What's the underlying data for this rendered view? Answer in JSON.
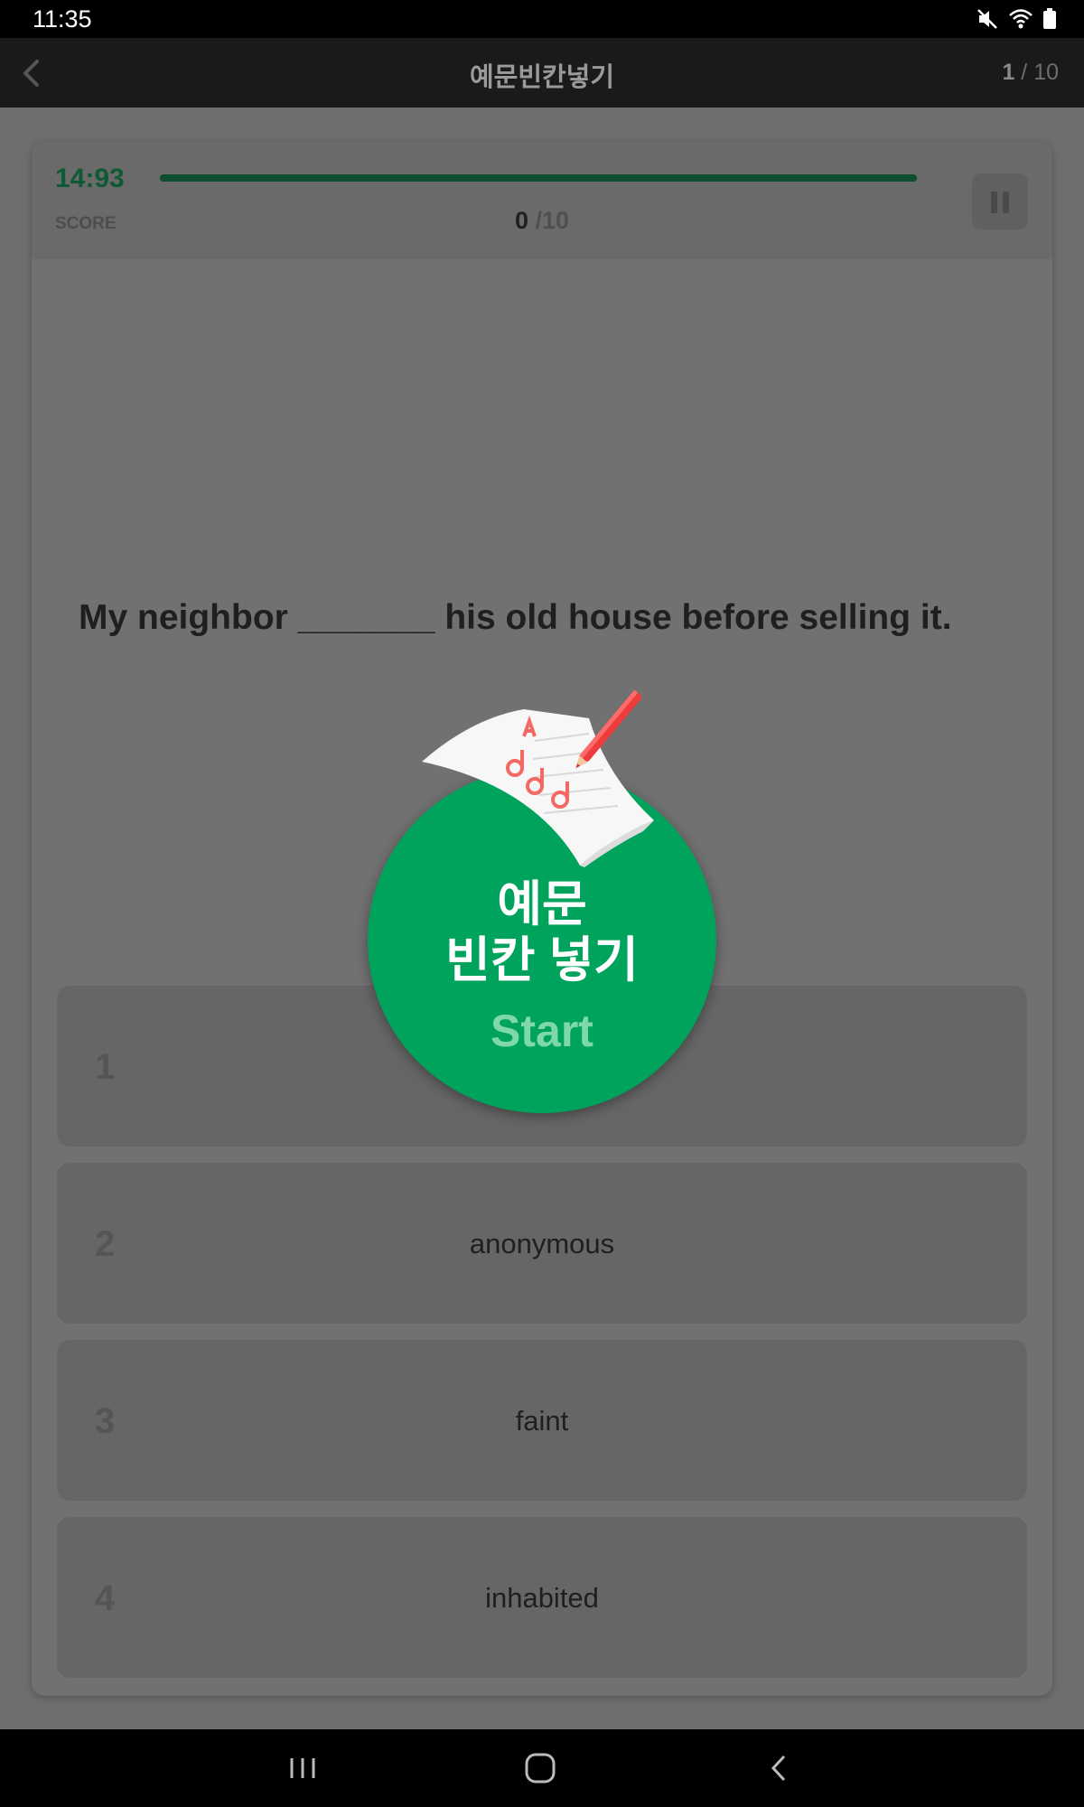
{
  "status_bar": {
    "time": "11:35",
    "icons": [
      "mute-icon",
      "wifi-icon",
      "battery-icon"
    ]
  },
  "app_bar": {
    "title": "예문빈칸넣기",
    "counter_current": "1",
    "counter_total": "/ 10"
  },
  "quiz": {
    "timer": "14:93",
    "score_label": "SCORE",
    "score_current": "0",
    "score_total": " /10",
    "time_remaining_fraction": 1.0,
    "question": "My neighbor _______ his old house before selling it.",
    "options": [
      {
        "number": "1",
        "text": ""
      },
      {
        "number": "2",
        "text": "anonymous"
      },
      {
        "number": "3",
        "text": "faint"
      },
      {
        "number": "4",
        "text": "inhabited"
      }
    ]
  },
  "start_overlay": {
    "title_line1": "예문",
    "title_line2": "빈칸 넣기",
    "start_label": "Start"
  },
  "colors": {
    "accent_green": "#00a35b",
    "timer_green": "#0e5a34",
    "start_text": "#7fd9a6"
  }
}
